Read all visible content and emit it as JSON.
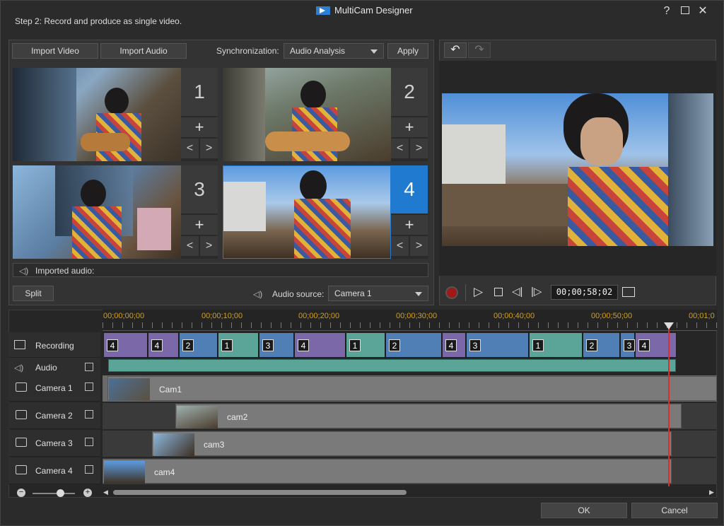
{
  "window": {
    "title": "MultiCam Designer",
    "step": "Step 2: Record and produce as single video."
  },
  "toolbar": {
    "import_video": "Import Video",
    "import_audio": "Import Audio",
    "sync_label": "Synchronization:",
    "sync_value": "Audio Analysis",
    "apply": "Apply"
  },
  "cameras": [
    {
      "num": "1",
      "plus": "+",
      "prev": "<",
      "next": ">"
    },
    {
      "num": "2",
      "plus": "+",
      "prev": "<",
      "next": ">"
    },
    {
      "num": "3",
      "plus": "+",
      "prev": "<",
      "next": ">"
    },
    {
      "num": "4",
      "plus": "+",
      "prev": "<",
      "next": ">"
    }
  ],
  "imported_audio": "Imported audio:",
  "split": "Split",
  "audio_source": {
    "label": "Audio source:",
    "value": "Camera 1"
  },
  "player": {
    "timecode": "00;00;58;02"
  },
  "ruler": [
    "00;00;00;00",
    "00;00;10;00",
    "00;00;20;00",
    "00;00;30;00",
    "00;00;40;00",
    "00;00;50;00",
    "00;01;0"
  ],
  "tracks": {
    "recording": "Recording",
    "audio": "Audio",
    "camera1": "Camera 1",
    "camera2": "Camera 2",
    "camera3": "Camera 3",
    "camera4": "Camera 4"
  },
  "clips": {
    "cam1": "Cam1",
    "cam2": "cam2",
    "cam3": "cam3",
    "cam4": "cam4"
  },
  "recording_segments": [
    "4",
    "4",
    "2",
    "1",
    "3",
    "4",
    "1",
    "2",
    "4",
    "3",
    "1",
    "2",
    "3",
    "4"
  ],
  "footer": {
    "ok": "OK",
    "cancel": "Cancel"
  },
  "colors": {
    "accent": "#1f7ad0",
    "seg_purple": "#7a68a8",
    "seg_blue": "#4f7fb5",
    "seg_teal": "#5aa597",
    "playhead": "#d83030"
  }
}
